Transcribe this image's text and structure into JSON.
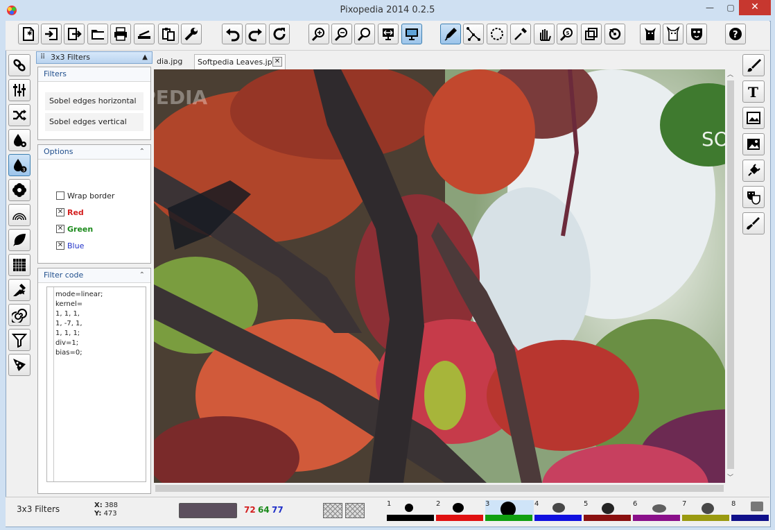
{
  "window": {
    "title": "Pixopedia 2014 0.2.5",
    "minimize": "—",
    "maximize": "▢",
    "close": "✕"
  },
  "toolbar": {
    "groups": [
      "file",
      "history",
      "view",
      "select-tools",
      "effects",
      "help"
    ],
    "buttons": [
      "new-image",
      "import",
      "export",
      "open",
      "print",
      "scanner",
      "clipboard",
      "settings",
      "undo",
      "redo",
      "refresh",
      "zoom-in",
      "zoom-out",
      "zoom-fit",
      "fit-width",
      "fullscreen-monitor",
      "pen",
      "path",
      "ellipse-select",
      "eyedropper",
      "hand",
      "zoom-tool",
      "crop",
      "rotate",
      "cat-filter",
      "cat-outline",
      "mask",
      "help"
    ]
  },
  "left_tools": [
    "link",
    "sliders",
    "shuffle",
    "ink-drop-gear",
    "ink-drop-3",
    "flower",
    "rainbow",
    "leaf",
    "grid",
    "stamp-star",
    "spiral",
    "funnel",
    "pizza"
  ],
  "right_tools": [
    "brush",
    "text",
    "image-frame",
    "image",
    "plug",
    "masks",
    "paint-brush"
  ],
  "panel": {
    "title": "3x3 Filters",
    "filters": {
      "heading": "Filters",
      "items": [
        "Sobel edges horizontal",
        "Sobel edges vertical"
      ]
    },
    "options": {
      "heading": "Options",
      "items": [
        {
          "label": "Wrap border",
          "checked": false,
          "color": "#222222"
        },
        {
          "label": "Red",
          "checked": true,
          "color": "#d42020"
        },
        {
          "label": "Green",
          "checked": true,
          "color": "#1b8a1b"
        },
        {
          "label": "Blue",
          "checked": true,
          "color": "#2030c8"
        }
      ]
    },
    "filter_code": {
      "heading": "Filter code",
      "lines": [
        "mode=linear;",
        "kernel=",
        "1, 1, 1,",
        "1, -7, 1,",
        "1, 1, 1;",
        "div=1;",
        "bias=0;"
      ]
    }
  },
  "tabs": [
    {
      "label": "dia.jpg",
      "active": false
    },
    {
      "label": "Softpedia Leaves.jpg",
      "active": true,
      "close": "✕"
    }
  ],
  "canvas": {
    "watermark_left": "SOFTPEDIA",
    "watermark_right": "SO"
  },
  "status": {
    "filter_name": "3x3 Filters",
    "x_label": "X:",
    "x_value": "388",
    "y_label": "Y:",
    "y_value": "473",
    "current_color": "#5c4f5e",
    "r": "72",
    "g": "64",
    "b": "77",
    "r_color": "#d42020",
    "g_color": "#1b8a1b",
    "b_color": "#2030c8"
  },
  "brushes": [
    {
      "num": "1",
      "color": "#000000"
    },
    {
      "num": "2",
      "color": "#e01010"
    },
    {
      "num": "3",
      "color": "#10a010"
    },
    {
      "num": "4",
      "color": "#1010e0"
    },
    {
      "num": "5",
      "color": "#8a1010"
    },
    {
      "num": "6",
      "color": "#8a108a"
    },
    {
      "num": "7",
      "color": "#9a9a10"
    },
    {
      "num": "8",
      "color": "#10108a"
    }
  ]
}
